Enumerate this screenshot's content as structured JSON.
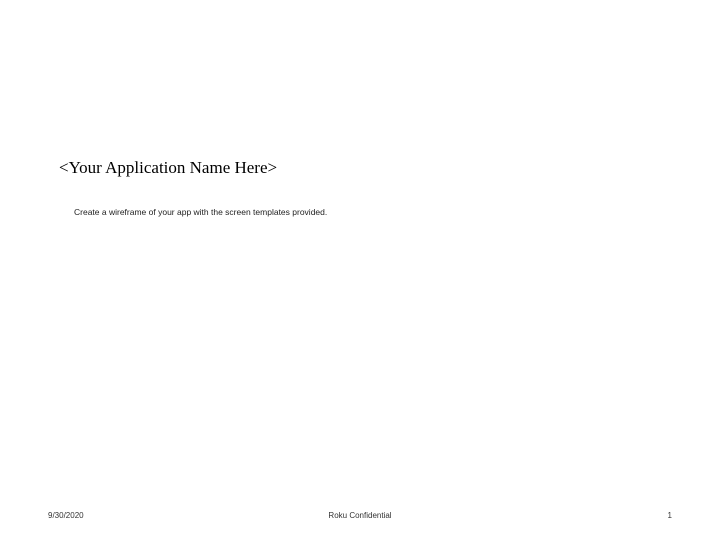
{
  "slide": {
    "title": "<Your Application Name Here>",
    "subtitle": "Create a wireframe of your app with the screen templates provided."
  },
  "footer": {
    "date": "9/30/2020",
    "center": "Roku Confidential",
    "page": "1"
  }
}
